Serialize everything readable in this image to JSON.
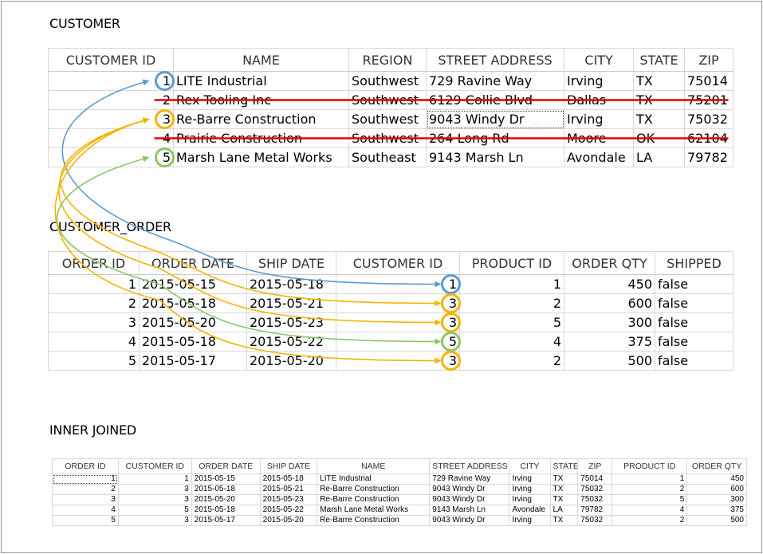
{
  "customer": {
    "title": "CUSTOMER",
    "columns": [
      "CUSTOMER ID",
      "NAME",
      "REGION",
      "STREET ADDRESS",
      "CITY",
      "STATE",
      "ZIP"
    ],
    "rows": [
      [
        "1",
        "LITE Industrial",
        "Southwest",
        "729 Ravine Way",
        "Irving",
        "TX",
        "75014"
      ],
      [
        "2",
        "Rex Tooling Inc",
        "Southwest",
        "6129 Collie Blvd",
        "Dallas",
        "TX",
        "75201"
      ],
      [
        "3",
        "Re-Barre Construction",
        "Southwest",
        "9043 Windy Dr",
        "Irving",
        "TX",
        "75032"
      ],
      [
        "4",
        "Prairie Construction",
        "Southwest",
        "264 Long Rd",
        "Moore",
        "OK",
        "62104"
      ],
      [
        "5",
        "Marsh Lane Metal Works",
        "Southeast",
        "9143 Marsh Ln",
        "Avondale",
        "LA",
        "79782"
      ]
    ],
    "excluded_customer_ids": [
      "2",
      "4"
    ]
  },
  "customer_order": {
    "title": "CUSTOMER_ORDER",
    "columns": [
      "ORDER ID",
      "ORDER DATE",
      "SHIP DATE",
      "CUSTOMER ID",
      "PRODUCT ID",
      "ORDER QTY",
      "SHIPPED"
    ],
    "rows": [
      [
        "1",
        "2015-05-15",
        "2015-05-18",
        "1",
        "1",
        "450",
        "false"
      ],
      [
        "2",
        "2015-05-18",
        "2015-05-21",
        "3",
        "2",
        "600",
        "false"
      ],
      [
        "3",
        "2015-05-20",
        "2015-05-23",
        "3",
        "5",
        "300",
        "false"
      ],
      [
        "4",
        "2015-05-18",
        "2015-05-22",
        "5",
        "4",
        "375",
        "false"
      ],
      [
        "5",
        "2015-05-17",
        "2015-05-20",
        "3",
        "2",
        "500",
        "false"
      ]
    ]
  },
  "inner_joined": {
    "title": "INNER JOINED",
    "columns": [
      "ORDER ID",
      "CUSTOMER ID",
      "ORDER DATE",
      "SHIP DATE",
      "NAME",
      "STREET ADDRESS",
      "CITY",
      "STATE",
      "ZIP",
      "PRODUCT ID",
      "ORDER QTY"
    ],
    "rows": [
      [
        "1",
        "1",
        "2015-05-15",
        "2015-05-18",
        "LITE Industrial",
        "729 Ravine Way",
        "Irving",
        "TX",
        "75014",
        "1",
        "450"
      ],
      [
        "2",
        "3",
        "2015-05-18",
        "2015-05-21",
        "Re-Barre Construction",
        "9043 Windy Dr",
        "Irving",
        "TX",
        "75032",
        "2",
        "600"
      ],
      [
        "3",
        "3",
        "2015-05-20",
        "2015-05-23",
        "Re-Barre Construction",
        "9043 Windy Dr",
        "Irving",
        "TX",
        "75032",
        "5",
        "300"
      ],
      [
        "4",
        "5",
        "2015-05-18",
        "2015-05-22",
        "Marsh Lane Metal Works",
        "9143 Marsh Ln",
        "Avondale",
        "LA",
        "79782",
        "4",
        "375"
      ],
      [
        "5",
        "3",
        "2015-05-17",
        "2015-05-20",
        "Re-Barre Construction",
        "9043 Windy Dr",
        "Irving",
        "TX",
        "75032",
        "2",
        "500"
      ]
    ]
  },
  "colors": {
    "customer_1": "#5b9bd5",
    "customer_3": "#f4b400",
    "customer_5": "#8fc46a",
    "strike": "#e60000"
  }
}
